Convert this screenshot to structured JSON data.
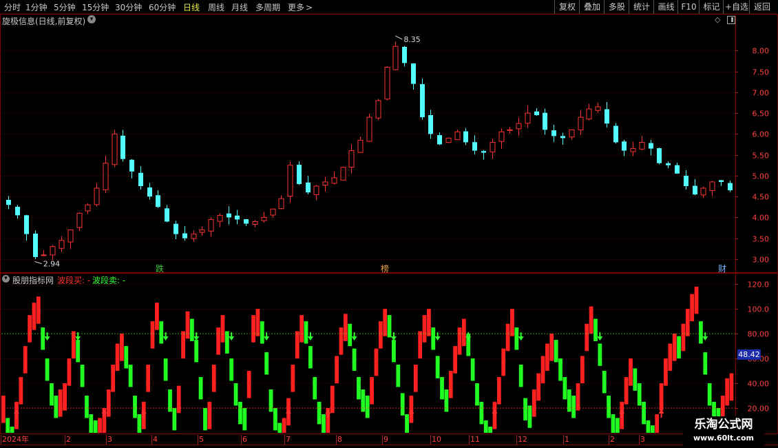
{
  "toolbar": {
    "periods": [
      "分时",
      "1分钟",
      "5分钟",
      "15分钟",
      "30分钟",
      "60分钟",
      "日线",
      "周线",
      "月线",
      "多周期",
      "更多"
    ],
    "active_period": "日线",
    "more_arrow": ">",
    "right_buttons": [
      "复权",
      "叠加",
      "多股",
      "统计",
      "画线",
      "F10",
      "标记",
      "+自选",
      "返回"
    ]
  },
  "main_panel": {
    "title": "旋极信息(日线,前复权)",
    "title_dropdown_icon": "chevron-down-circle-icon",
    "corner_icons": [
      "diamond-icon",
      "maximize-icon"
    ],
    "high_label": "8.35",
    "low_label": "2.94",
    "markers": [
      {
        "text": "跌",
        "color": "#3cc83c"
      },
      {
        "text": "榜",
        "color": "#e8a040"
      },
      {
        "text": "财",
        "color": "#7ab8ff"
      }
    ]
  },
  "indicator_panel": {
    "title": "股朋指标网",
    "line1_label": "波段买: -",
    "line2_label": "波段卖: -",
    "current_value": "48.42"
  },
  "x_axis": {
    "labels": [
      "2024年",
      "2",
      "3",
      "4",
      "5",
      "6",
      "7",
      "8",
      "9",
      "10",
      "11",
      "12",
      "1",
      "2",
      "3"
    ]
  },
  "watermark": {
    "title": "乐淘公式网",
    "url": "www.60lt.com"
  },
  "chart_data": [
    {
      "type": "candlestick",
      "title": "旋极信息(日线,前复权)",
      "y_ticks": [
        3.0,
        3.5,
        4.0,
        4.5,
        5.0,
        5.5,
        6.0,
        6.5,
        7.0,
        7.5,
        8.0
      ],
      "ylim": [
        2.85,
        8.55
      ],
      "grid": true,
      "annotations": [
        {
          "label": "8.35",
          "x": "9",
          "y": 8.35
        },
        {
          "label": "2.94",
          "x": "2024年",
          "y": 2.94
        }
      ],
      "colors": {
        "up": "#ff3232",
        "down": "#54ffff"
      },
      "closes": [
        4.3,
        4.05,
        3.6,
        3.05,
        3.1,
        3.3,
        3.45,
        3.7,
        4.1,
        4.3,
        4.7,
        5.3,
        6.0,
        5.4,
        5.1,
        4.75,
        4.5,
        4.25,
        3.9,
        3.6,
        3.5,
        3.6,
        3.7,
        3.95,
        4.05,
        4.0,
        3.95,
        3.85,
        3.9,
        4.0,
        4.2,
        4.45,
        5.25,
        4.8,
        4.6,
        4.75,
        4.85,
        4.95,
        5.2,
        5.6,
        5.85,
        6.4,
        6.8,
        7.6,
        8.1,
        7.7,
        7.2,
        6.4,
        6.0,
        5.75,
        5.9,
        6.05,
        5.8,
        5.6,
        5.55,
        5.8,
        6.05,
        6.1,
        6.25,
        6.5,
        6.45,
        6.1,
        5.95,
        5.9,
        6.1,
        6.4,
        6.6,
        6.65,
        6.25,
        5.8,
        5.6,
        5.65,
        5.8,
        5.65,
        5.3,
        5.25,
        5.05,
        4.75,
        4.55,
        4.7,
        4.85,
        4.85,
        4.65
      ]
    },
    {
      "type": "bar",
      "name": "股朋指标网",
      "y_ticks": [
        20.0,
        40.0,
        60.0,
        80.0,
        100.0,
        120.0
      ],
      "ylim": [
        0,
        124
      ],
      "grid": true,
      "reference_lines": [
        20,
        80
      ],
      "current_value": 48.42,
      "colors": {
        "rising": "#ff2020",
        "falling": "#20ff20",
        "buy_arrow": "#ff3030",
        "sell_arrow": "#33ff33"
      },
      "values": [
        30,
        12,
        5,
        25,
        45,
        70,
        95,
        105,
        110,
        85,
        60,
        40,
        30,
        35,
        40,
        60,
        82,
        75,
        55,
        30,
        15,
        10,
        12,
        20,
        35,
        55,
        72,
        80,
        70,
        55,
        30,
        15,
        25,
        55,
        90,
        105,
        90,
        60,
        35,
        20,
        38,
        82,
        98,
        92,
        75,
        45,
        20,
        25,
        55,
        85,
        95,
        82,
        60,
        40,
        25,
        20,
        50,
        95,
        100,
        90,
        65,
        35,
        20,
        8,
        12,
        28,
        55,
        82,
        95,
        90,
        70,
        45,
        25,
        15,
        20,
        38,
        62,
        85,
        96,
        88,
        68,
        45,
        35,
        30,
        45,
        68,
        90,
        100,
        95,
        75,
        55,
        32,
        15,
        30,
        55,
        82,
        95,
        100,
        85,
        62,
        45,
        35,
        50,
        70,
        85,
        92,
        80,
        60,
        40,
        25,
        10,
        5,
        25,
        45,
        68,
        88,
        100,
        85,
        55,
        28,
        22,
        35,
        48,
        62,
        72,
        80,
        75,
        60,
        45,
        35,
        30,
        40,
        62,
        88,
        102,
        92,
        72,
        50,
        30,
        15,
        12,
        25,
        45,
        60,
        52,
        40,
        25,
        10,
        6,
        15,
        40,
        60,
        72,
        80,
        78,
        88,
        100,
        112,
        118,
        90,
        65,
        40,
        25,
        20,
        30,
        44,
        48
      ]
    }
  ]
}
